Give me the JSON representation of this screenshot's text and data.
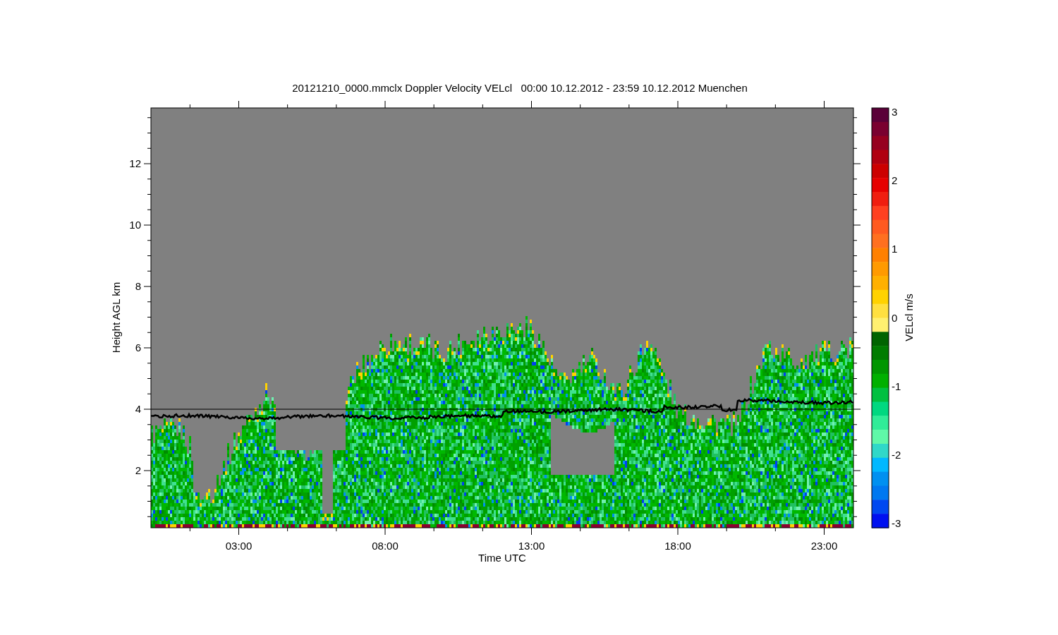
{
  "title": "20121210_0000.mmclx Doppler Velocity VELcl   00:00 10.12.2012 - 23:59 10.12.2012 Muenchen",
  "y_axis": {
    "label": "Height AGL km",
    "ticks": [
      "12",
      "10",
      "8",
      "6",
      "4",
      "2"
    ]
  },
  "x_axis": {
    "label": "Time UTC",
    "ticks": [
      "03:00",
      "08:00",
      "13:00",
      "18:00",
      "23:00"
    ]
  },
  "colorbar": {
    "label": "VELcl m/s",
    "ticks": [
      "3",
      "2",
      "1",
      "0",
      "-1",
      "-2",
      "-3"
    ]
  }
}
